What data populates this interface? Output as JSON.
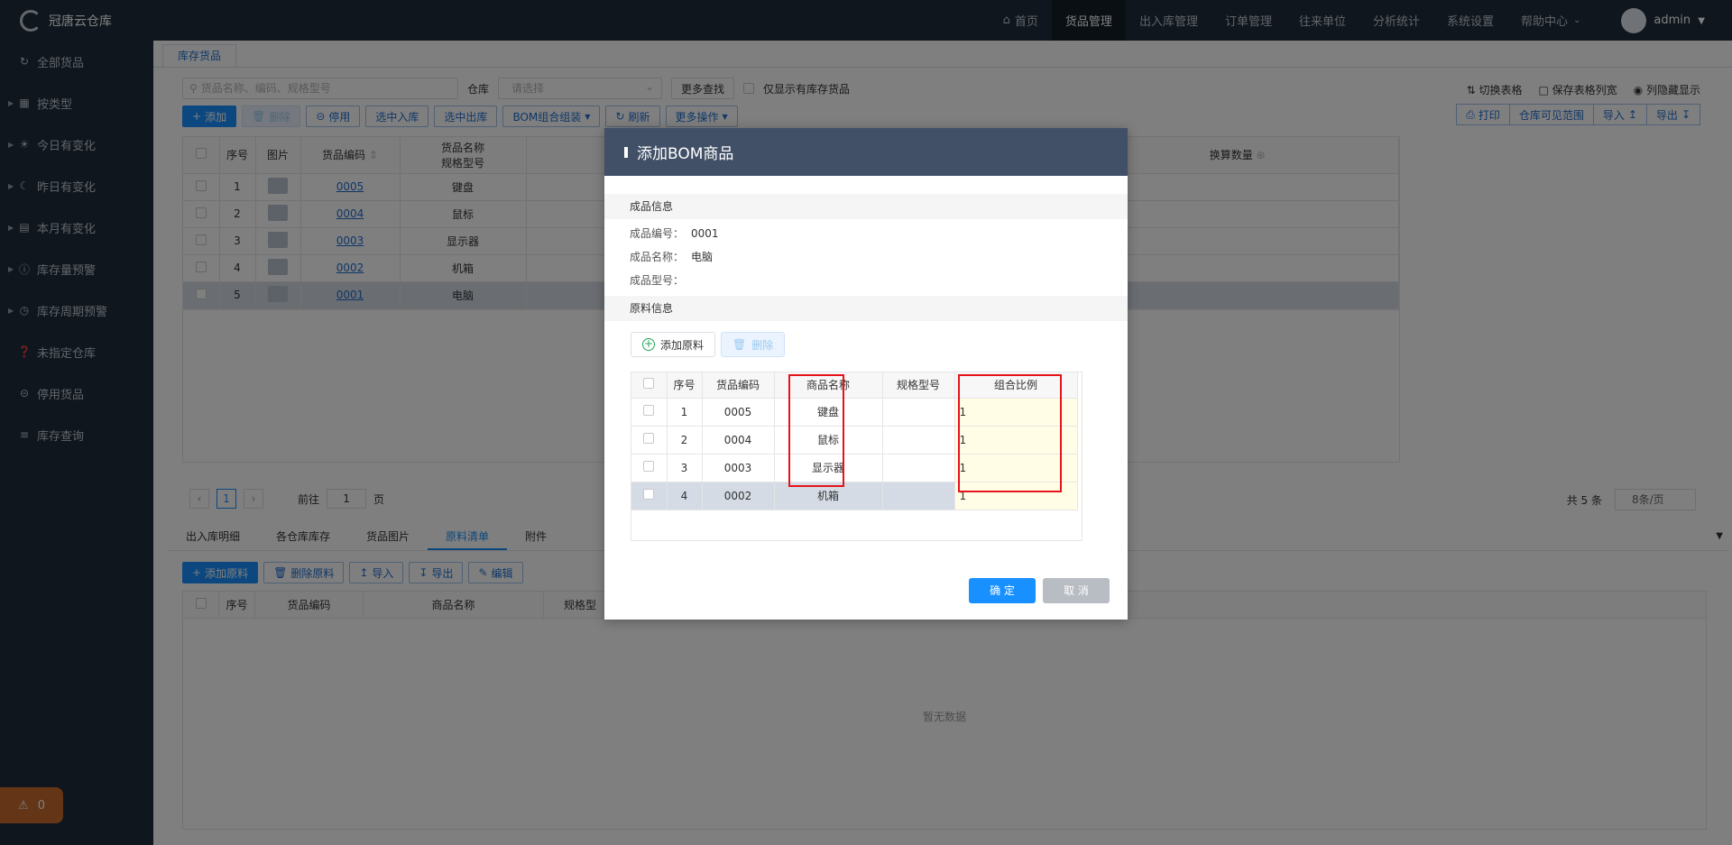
{
  "app": {
    "title": "冠唐云仓库"
  },
  "sidebar": {
    "items": [
      {
        "label": "全部货品",
        "icon": "refresh-icon",
        "arrow": false
      },
      {
        "label": "按类型",
        "icon": "grid-icon",
        "arrow": true
      },
      {
        "label": "今日有变化",
        "icon": "sun-icon",
        "arrow": true
      },
      {
        "label": "昨日有变化",
        "icon": "moon-icon",
        "arrow": true
      },
      {
        "label": "本月有变化",
        "icon": "calendar-icon",
        "arrow": true
      },
      {
        "label": "库存量预警",
        "icon": "warning-icon",
        "arrow": true
      },
      {
        "label": "库存周期预警",
        "icon": "alarm-clock-icon",
        "arrow": true
      },
      {
        "label": "未指定仓库",
        "icon": "question-icon",
        "arrow": false
      },
      {
        "label": "停用货品",
        "icon": "minus-circle-icon",
        "arrow": false
      },
      {
        "label": "库存查询",
        "icon": "list-icon",
        "arrow": false
      }
    ],
    "alarm_count": "0"
  },
  "topnav": {
    "items": [
      "首页",
      "货品管理",
      "出入库管理",
      "订单管理",
      "往来单位",
      "分析统计",
      "系统设置",
      "帮助中心"
    ],
    "active": 1,
    "user": "admin"
  },
  "page": {
    "tab": "库存货品",
    "search_placeholder": "货品名称、编码、规格型号",
    "warehouse_label": "仓库",
    "warehouse_placeholder": "请选择",
    "more_search": "更多查找",
    "only_stock": "仅显示有库存货品",
    "toolbar": [
      "添加",
      "删除",
      "停用",
      "选中入库",
      "选中出库",
      "BOM组合组装",
      "刷新",
      "更多操作"
    ],
    "right_tools": [
      "切换表格",
      "保存表格列宽",
      "列隐藏显示"
    ],
    "right_buttons": [
      "打印",
      "仓库可见范围",
      "导入",
      "导出"
    ],
    "table": {
      "headers": [
        "序号",
        "图片",
        "货品编码",
        "货品名称",
        "规格型号",
        "换算数量"
      ],
      "rows": [
        {
          "no": "1",
          "code": "0005",
          "name": "键盘"
        },
        {
          "no": "2",
          "code": "0004",
          "name": "鼠标"
        },
        {
          "no": "3",
          "code": "0003",
          "name": "显示器"
        },
        {
          "no": "4",
          "code": "0002",
          "name": "机箱"
        },
        {
          "no": "5",
          "code": "0001",
          "name": "电脑"
        }
      ]
    },
    "pager": {
      "current": "1",
      "goto_label": "前往",
      "goto_value": "1",
      "page_suffix": "页",
      "total": "共 5 条",
      "size": "8条/页"
    },
    "bottom_tabs": [
      "出入库明细",
      "各仓库库存",
      "货品图片",
      "原料清单",
      "附件"
    ],
    "bottom_active": 3,
    "bottom_toolbar": [
      "添加原料",
      "删除原料",
      "导入",
      "导出",
      "编辑"
    ],
    "bottom_headers": [
      "序号",
      "货品编码",
      "商品名称",
      "规格型"
    ],
    "no_data": "暂无数据"
  },
  "dialog": {
    "title": "添加BOM商品",
    "product_section": "成品信息",
    "code_label": "成品编号：",
    "code": "0001",
    "name_label": "成品名称：",
    "name": "电脑",
    "model_label": "成品型号：",
    "model": "",
    "material_section": "原料信息",
    "add_material": "添加原料",
    "delete": "删除",
    "headers": [
      "序号",
      "货品编码",
      "商品名称",
      "规格型号",
      "组合比例"
    ],
    "rows": [
      {
        "no": "1",
        "code": "0005",
        "name": "键盘",
        "model": "",
        "ratio": "1"
      },
      {
        "no": "2",
        "code": "0004",
        "name": "鼠标",
        "model": "",
        "ratio": "1"
      },
      {
        "no": "3",
        "code": "0003",
        "name": "显示器",
        "model": "",
        "ratio": "1"
      },
      {
        "no": "4",
        "code": "0002",
        "name": "机箱",
        "model": "",
        "ratio": "1"
      }
    ],
    "ok": "确 定",
    "cancel": "取 消"
  }
}
